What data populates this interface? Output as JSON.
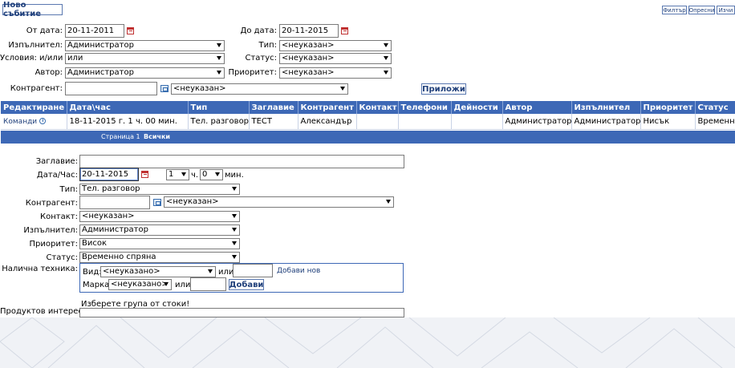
{
  "toolbar": {
    "new_event": "Ново събитие",
    "filter": "Филтър",
    "refresh": "Опресни",
    "delete": "Изчи"
  },
  "filter": {
    "from_date_label": "От дата:",
    "from_date": "20-11-2011",
    "to_date_label": "До дата:",
    "to_date": "20-11-2015",
    "executor_label": "Изпълнител:",
    "executor": "Администратор",
    "type_label": "Тип:",
    "type": "<неуказан>",
    "conditions_label": "Условия: и/или",
    "conditions": "или",
    "status_label": "Статус:",
    "status": "<неуказан>",
    "author_label": "Автор:",
    "author": "Администратор",
    "priority_label": "Приоритет:",
    "priority": "<неуказан>",
    "contractor_label": "Контрагент:",
    "contractor_value": "",
    "contractor_select": "<неуказан>",
    "apply": "Приложи"
  },
  "grid": {
    "headers": [
      "Редактиране",
      "Дата\\час",
      "Тип",
      "Заглавие",
      "Контрагент",
      "Контакт",
      "Телефони",
      "Дейности",
      "Автор",
      "Изпълнител",
      "Приоритет",
      "Статус"
    ],
    "rows": [
      {
        "edit": "Команди",
        "datetime": "18-11-2015 г. 1 ч. 00 мин.",
        "type": "Тел. разговор",
        "title": "ТЕСТ",
        "contractor": "Александър",
        "contact": "",
        "phones": "",
        "activities": "",
        "author": "Администратор",
        "executor": "Администратор",
        "priority": "Нисък",
        "status": "Временно"
      }
    ],
    "pager_page": "Страница 1",
    "pager_all": "Всички"
  },
  "form": {
    "title_label": "Заглавие:",
    "title_value": "",
    "datetime_label": "Дата/Час:",
    "date_value": "20-11-2015",
    "hour": "1",
    "hour_unit": "ч.",
    "minute": "0",
    "minute_unit": "мин.",
    "type_label": "Тип:",
    "type": "Тел. разговор",
    "contractor_label": "Контрагент:",
    "contractor_value": "",
    "contractor_select": "<неуказан>",
    "contact_label": "Контакт:",
    "contact": "<неуказан>",
    "executor_label": "Изпълнител:",
    "executor": "Администратор",
    "priority_label": "Приоритет:",
    "priority": "Висок",
    "status_label": "Статус:",
    "status": "Временно спряна",
    "equipment_label": "Налична техника:",
    "kind_label": "Вид:",
    "kind": "<неуказано>",
    "or1": "или",
    "add_new": "Добави нов",
    "brand_label": "Марка:",
    "brand": "<неуказано>",
    "or2": "или",
    "add": "Добави",
    "choose_group": "Изберете група от стоки!",
    "products_label": "Продуктов интерес:"
  },
  "colors": {
    "header_blue": "#3d68b6",
    "border_blue": "#5a78b0"
  }
}
